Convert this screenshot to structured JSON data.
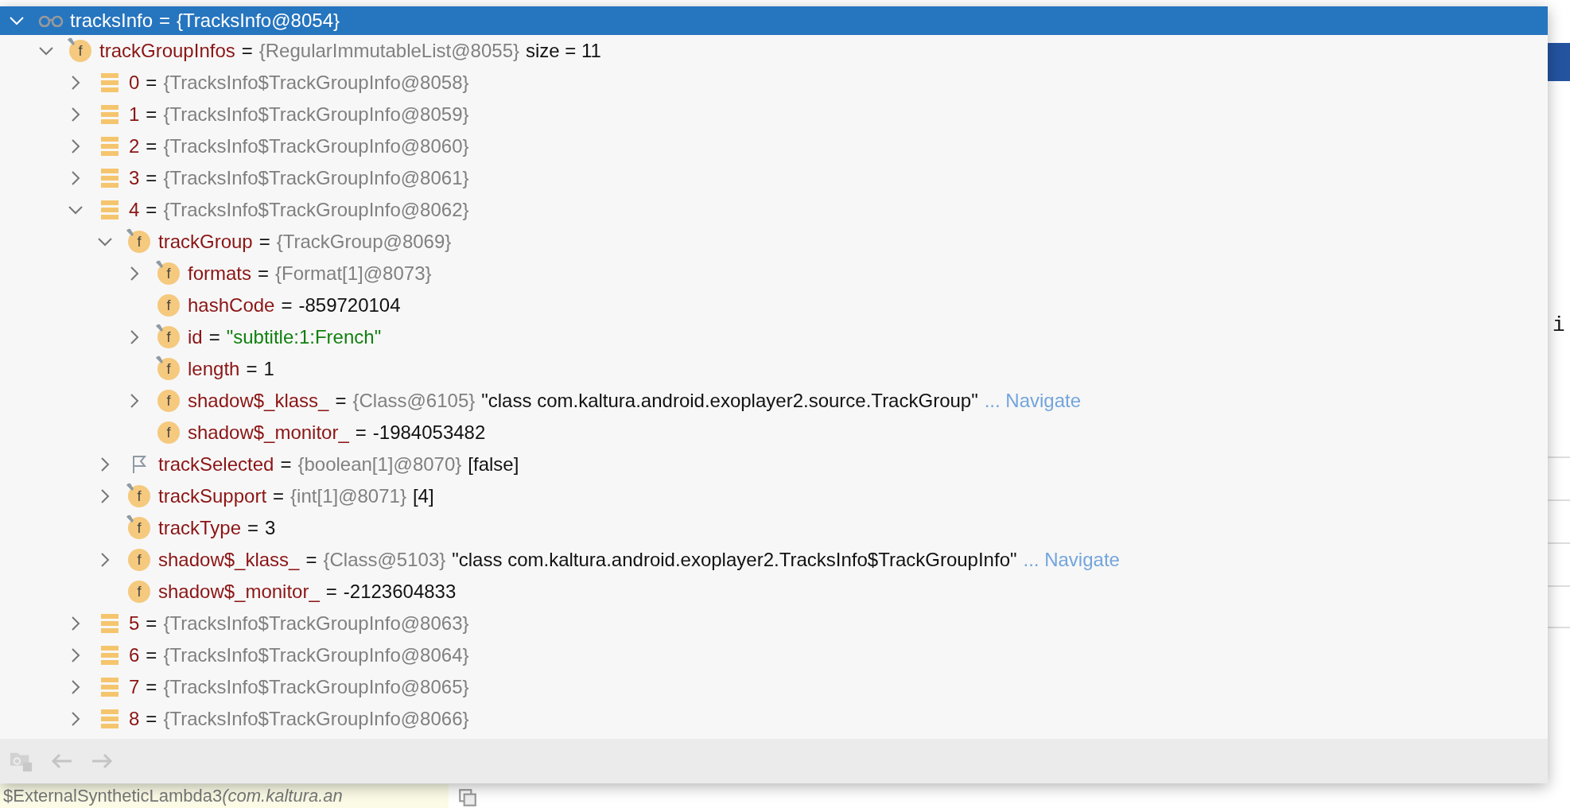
{
  "tree": [
    {
      "kind": "watch",
      "name": "tracksInfo",
      "sep": "=",
      "ref": "{TracksInfo@8054}",
      "expanded": true,
      "selected": true,
      "children": [
        {
          "kind": "field",
          "icon": "f",
          "badge": true,
          "name": "trackGroupInfos",
          "sep": "=",
          "ref": "{RegularImmutableList@8055}",
          "extra": "size = 11",
          "expanded": true,
          "selected": false,
          "children": [
            {
              "kind": "element",
              "name": "0",
              "sep": "=",
              "ref": "{TracksInfo$TrackGroupInfo@8058}",
              "expanded": false,
              "selected": false
            },
            {
              "kind": "element",
              "name": "1",
              "sep": "=",
              "ref": "{TracksInfo$TrackGroupInfo@8059}",
              "expanded": false,
              "selected": false
            },
            {
              "kind": "element",
              "name": "2",
              "sep": "=",
              "ref": "{TracksInfo$TrackGroupInfo@8060}",
              "expanded": false,
              "selected": false
            },
            {
              "kind": "element",
              "name": "3",
              "sep": "=",
              "ref": "{TracksInfo$TrackGroupInfo@8061}",
              "expanded": false,
              "selected": false
            },
            {
              "kind": "element",
              "name": "4",
              "sep": "=",
              "ref": "{TracksInfo$TrackGroupInfo@8062}",
              "expanded": true,
              "selected": false,
              "children": [
                {
                  "kind": "field",
                  "icon": "f",
                  "badge": true,
                  "name": "trackGroup",
                  "sep": "=",
                  "ref": "{TrackGroup@8069}",
                  "expanded": true,
                  "selected": false,
                  "children": [
                    {
                      "kind": "field",
                      "icon": "f",
                      "badge": true,
                      "name": "formats",
                      "sep": "=",
                      "ref": "{Format[1]@8073}",
                      "expanded": false,
                      "selected": false
                    },
                    {
                      "kind": "field",
                      "icon": "f",
                      "badge": false,
                      "name": "hashCode",
                      "sep": "=",
                      "value": "-859720104",
                      "selected": false
                    },
                    {
                      "kind": "field",
                      "icon": "f",
                      "badge": true,
                      "name": "id",
                      "sep": "=",
                      "string": "\"subtitle:1:French\"",
                      "expanded": false,
                      "selected": false
                    },
                    {
                      "kind": "field",
                      "icon": "f",
                      "badge": true,
                      "name": "length",
                      "sep": "=",
                      "value": "1",
                      "selected": false
                    },
                    {
                      "kind": "field",
                      "icon": "f",
                      "badge": false,
                      "name": "shadow$_klass_",
                      "sep": "=",
                      "ref": "{Class@6105}",
                      "value": "\"class com.kaltura.android.exoplayer2.source.TrackGroup\"",
                      "link": "... Navigate",
                      "expanded": false,
                      "selected": false
                    },
                    {
                      "kind": "field",
                      "icon": "f",
                      "badge": false,
                      "name": "shadow$_monitor_",
                      "sep": "=",
                      "value": "-1984053482",
                      "selected": false
                    }
                  ]
                },
                {
                  "kind": "flag",
                  "name": "trackSelected",
                  "sep": "=",
                  "ref": "{boolean[1]@8070}",
                  "value": "[false]",
                  "expanded": false,
                  "selected": false
                },
                {
                  "kind": "field",
                  "icon": "f",
                  "badge": true,
                  "name": "trackSupport",
                  "sep": "=",
                  "ref": "{int[1]@8071}",
                  "value": "[4]",
                  "expanded": false,
                  "selected": false
                },
                {
                  "kind": "field",
                  "icon": "f",
                  "badge": true,
                  "name": "trackType",
                  "sep": "=",
                  "value": "3",
                  "selected": false
                },
                {
                  "kind": "field",
                  "icon": "f",
                  "badge": false,
                  "name": "shadow$_klass_",
                  "sep": "=",
                  "ref": "{Class@5103}",
                  "value": "\"class com.kaltura.android.exoplayer2.TracksInfo$TrackGroupInfo\"",
                  "link": "... Navigate",
                  "expanded": false,
                  "selected": false
                },
                {
                  "kind": "field",
                  "icon": "f",
                  "badge": false,
                  "name": "shadow$_monitor_",
                  "sep": "=",
                  "value": "-2123604833",
                  "selected": false
                }
              ]
            },
            {
              "kind": "element",
              "name": "5",
              "sep": "=",
              "ref": "{TracksInfo$TrackGroupInfo@8063}",
              "expanded": false,
              "selected": false
            },
            {
              "kind": "element",
              "name": "6",
              "sep": "=",
              "ref": "{TracksInfo$TrackGroupInfo@8064}",
              "expanded": false,
              "selected": false
            },
            {
              "kind": "element",
              "name": "7",
              "sep": "=",
              "ref": "{TracksInfo$TrackGroupInfo@8065}",
              "expanded": false,
              "selected": false
            },
            {
              "kind": "element",
              "name": "8",
              "sep": "=",
              "ref": "{TracksInfo$TrackGroupInfo@8066}",
              "expanded": false,
              "selected": false
            }
          ]
        }
      ]
    }
  ],
  "editor": {
    "side_text": "i",
    "code": "$ExternalSyntheticLambda3",
    "hint": "(com.kaltura.an"
  }
}
